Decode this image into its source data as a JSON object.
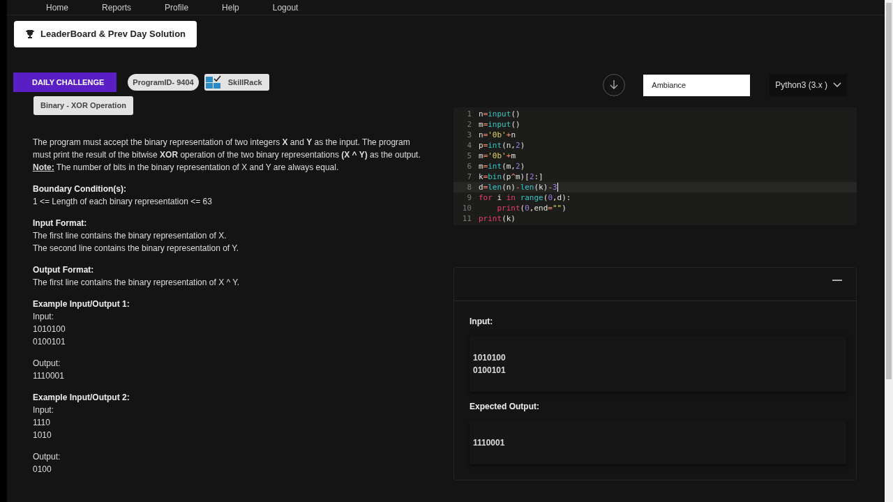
{
  "nav": [
    "Home",
    "Reports",
    "Profile",
    "Help",
    "Logout"
  ],
  "leaderboard_button": "LeaderBoard & Prev Day Solution",
  "challenge": {
    "ribbon": "DAILY CHALLENGE",
    "program_id": "ProgramID- 9404",
    "brand": "SkillRack",
    "title": "Binary - XOR Operation"
  },
  "description": "The program must accept the binary representation of two integers **X** and **Y** as the input. The program must print the result of the bitwise **XOR** operation of the two binary representations **(X ^ Y)** as the output.",
  "note": {
    "label": "Note:",
    "text": "The number of bits in the binary representation of X and Y are always equal."
  },
  "sections": [
    {
      "heading": "Boundary Condition(s):",
      "lines": [
        "1 <= Length of each binary representation <= 63"
      ]
    },
    {
      "heading": "Input Format:",
      "lines": [
        "The first line contains the binary representation of X.",
        "The second line contains the binary representation of Y."
      ]
    },
    {
      "heading": "Output Format:",
      "lines": [
        "The first line contains the binary representation of X ^ Y."
      ]
    }
  ],
  "examples": [
    {
      "heading": "Example Input/Output 1:",
      "input_label": "Input:",
      "input": [
        "1010100",
        "0100101"
      ],
      "output_label": "Output:",
      "output": [
        "1110001"
      ]
    },
    {
      "heading": "Example Input/Output 2:",
      "input_label": "Input:",
      "input": [
        "1110",
        "1010"
      ],
      "output_label": "Output:",
      "output": [
        "0100"
      ]
    }
  ],
  "editor": {
    "theme": "Ambiance",
    "language": "Python3 (3.x )",
    "lines": [
      {
        "number": "1",
        "active": false,
        "tokens": [
          {
            "kind": "var",
            "text": "n"
          },
          {
            "kind": "op",
            "text": "="
          },
          {
            "kind": "fn",
            "text": "input"
          },
          {
            "kind": "var",
            "text": "()"
          }
        ]
      },
      {
        "number": "2",
        "active": false,
        "tokens": [
          {
            "kind": "var",
            "text": "m"
          },
          {
            "kind": "op",
            "text": "="
          },
          {
            "kind": "fn",
            "text": "input"
          },
          {
            "kind": "var",
            "text": "()"
          }
        ]
      },
      {
        "number": "3",
        "active": false,
        "tokens": [
          {
            "kind": "var",
            "text": "n"
          },
          {
            "kind": "op",
            "text": "="
          },
          {
            "kind": "str",
            "text": "'0b'"
          },
          {
            "kind": "op",
            "text": "+"
          },
          {
            "kind": "var",
            "text": "n"
          }
        ]
      },
      {
        "number": "4",
        "active": false,
        "tokens": [
          {
            "kind": "var",
            "text": "p"
          },
          {
            "kind": "op",
            "text": "="
          },
          {
            "kind": "fn",
            "text": "int"
          },
          {
            "kind": "var",
            "text": "(n,"
          },
          {
            "kind": "num",
            "text": "2"
          },
          {
            "kind": "var",
            "text": ")"
          }
        ]
      },
      {
        "number": "5",
        "active": false,
        "tokens": [
          {
            "kind": "var",
            "text": "m"
          },
          {
            "kind": "op",
            "text": "="
          },
          {
            "kind": "str",
            "text": "'0b'"
          },
          {
            "kind": "op",
            "text": "+"
          },
          {
            "kind": "var",
            "text": "m"
          }
        ]
      },
      {
        "number": "6",
        "active": false,
        "tokens": [
          {
            "kind": "var",
            "text": "m"
          },
          {
            "kind": "op",
            "text": "="
          },
          {
            "kind": "fn",
            "text": "int"
          },
          {
            "kind": "var",
            "text": "(m,"
          },
          {
            "kind": "num",
            "text": "2"
          },
          {
            "kind": "var",
            "text": ")"
          }
        ]
      },
      {
        "number": "7",
        "active": false,
        "tokens": [
          {
            "kind": "var",
            "text": "k"
          },
          {
            "kind": "op",
            "text": "="
          },
          {
            "kind": "fn",
            "text": "bin"
          },
          {
            "kind": "var",
            "text": "(p"
          },
          {
            "kind": "op",
            "text": "^"
          },
          {
            "kind": "var",
            "text": "m)["
          },
          {
            "kind": "num",
            "text": "2"
          },
          {
            "kind": "var",
            "text": ":]"
          }
        ]
      },
      {
        "number": "8",
        "active": true,
        "tokens": [
          {
            "kind": "var",
            "text": "d"
          },
          {
            "kind": "op",
            "text": "="
          },
          {
            "kind": "fn",
            "text": "len"
          },
          {
            "kind": "var",
            "text": "(n)"
          },
          {
            "kind": "op",
            "text": "-"
          },
          {
            "kind": "fn",
            "text": "len"
          },
          {
            "kind": "var",
            "text": "(k)"
          },
          {
            "kind": "op",
            "text": "-"
          },
          {
            "kind": "num",
            "text": "3"
          }
        ]
      },
      {
        "number": "9",
        "active": false,
        "tokens": [
          {
            "kind": "kw",
            "text": "for"
          },
          {
            "kind": "var",
            "text": " i "
          },
          {
            "kind": "kw",
            "text": "in "
          },
          {
            "kind": "fn",
            "text": "range"
          },
          {
            "kind": "var",
            "text": "("
          },
          {
            "kind": "num",
            "text": "0"
          },
          {
            "kind": "var",
            "text": ",d):"
          }
        ]
      },
      {
        "number": "10",
        "active": false,
        "tokens": [
          {
            "kind": "kw",
            "text": "    print"
          },
          {
            "kind": "var",
            "text": "("
          },
          {
            "kind": "num",
            "text": "0"
          },
          {
            "kind": "var",
            "text": ",end"
          },
          {
            "kind": "op",
            "text": "="
          },
          {
            "kind": "str",
            "text": "\"\""
          },
          {
            "kind": "var",
            "text": ")"
          }
        ]
      },
      {
        "number": "11",
        "active": false,
        "tokens": [
          {
            "kind": "kw",
            "text": "print"
          },
          {
            "kind": "var",
            "text": "(k)"
          }
        ]
      }
    ]
  },
  "test_panel": {
    "input_label": "Input:",
    "input": [
      "1010100",
      "0100101"
    ],
    "expected_label": "Expected Output:",
    "expected": [
      "1110001"
    ]
  }
}
